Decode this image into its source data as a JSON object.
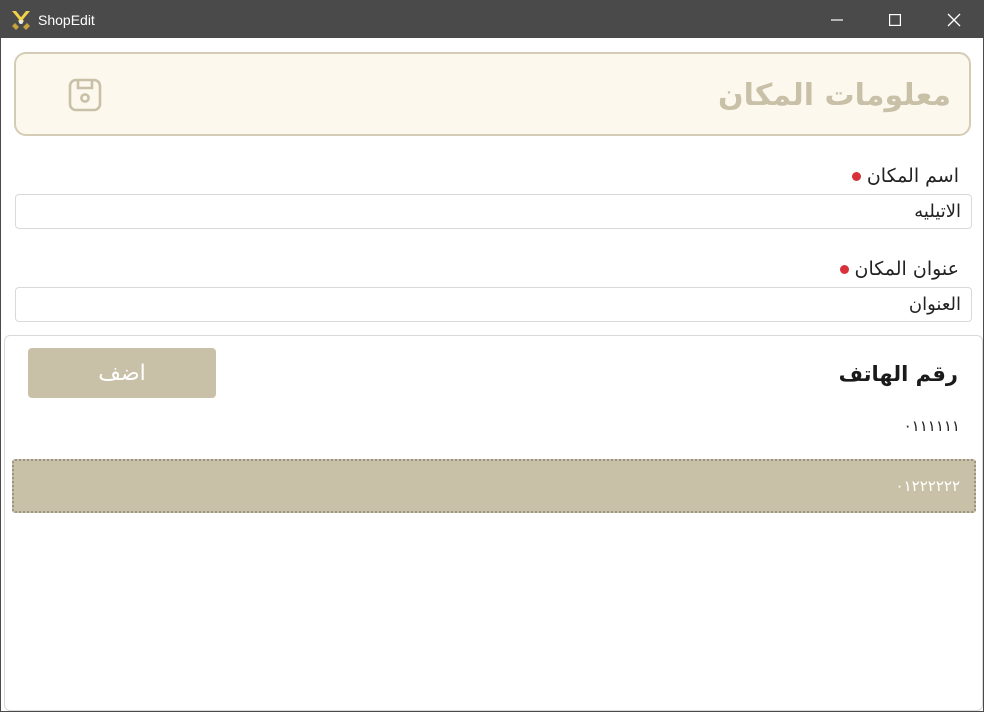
{
  "window": {
    "title": "ShopEdit",
    "app_icon": "crossed-swords-icon",
    "controls": {
      "minimize_icon": "minimize-icon",
      "maximize_icon": "maximize-icon",
      "close_icon": "close-icon"
    }
  },
  "header": {
    "title": "معلومات المكان",
    "save_icon": "save-icon"
  },
  "form": {
    "name_label": "اسم المكان",
    "name_value": "الاتيليه",
    "address_label": "عنوان المكان",
    "address_value": "العنوان",
    "required_color": "#d8313a"
  },
  "phones": {
    "title": "رقم الهاتف",
    "add_label": "اضف",
    "items": [
      "٠١١١١١١",
      "٠١٢٢٢٢٢٢"
    ],
    "selected_index": 1
  },
  "colors": {
    "accent": "#c9c0a8",
    "header_bg": "#fdf8ee",
    "titlebar": "#4a4a4a"
  }
}
